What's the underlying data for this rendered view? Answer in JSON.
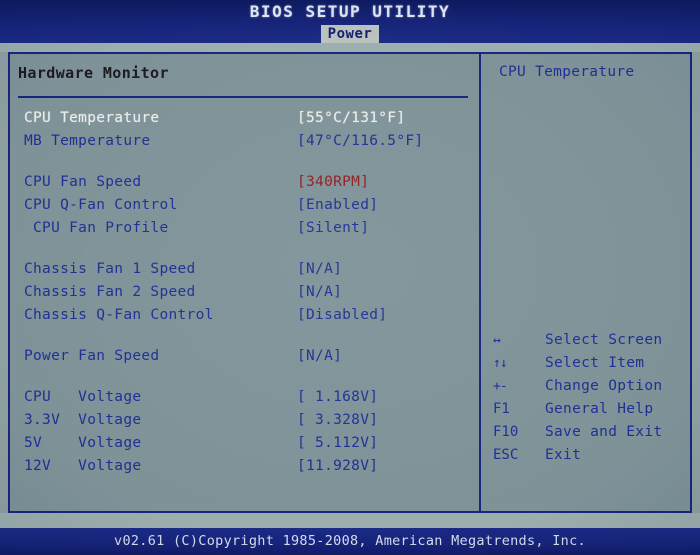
{
  "header": {
    "title": "BIOS SETUP UTILITY",
    "tabs": [
      {
        "label": "Power",
        "active": true
      }
    ]
  },
  "main": {
    "section_title": "Hardware Monitor",
    "rows": [
      {
        "label": "CPU Temperature",
        "value": "[55°C/131°F]",
        "selected": true,
        "alert": false
      },
      {
        "label": "MB Temperature",
        "value": "[47°C/116.5°F]",
        "selected": false,
        "alert": false
      },
      {
        "spacer": true
      },
      {
        "label": "CPU Fan Speed",
        "value": "[340RPM]",
        "selected": false,
        "alert": true
      },
      {
        "label": "CPU Q-Fan Control",
        "value": "[Enabled]",
        "selected": false,
        "alert": false
      },
      {
        "label": " CPU Fan Profile",
        "value": "[Silent]",
        "selected": false,
        "alert": false
      },
      {
        "spacer": true
      },
      {
        "label": "Chassis Fan 1 Speed",
        "value": "[N/A]",
        "selected": false,
        "alert": false
      },
      {
        "label": "Chassis Fan 2 Speed",
        "value": "[N/A]",
        "selected": false,
        "alert": false
      },
      {
        "label": "Chassis Q-Fan Control",
        "value": "[Disabled]",
        "selected": false,
        "alert": false
      },
      {
        "spacer": true
      },
      {
        "label": "Power Fan Speed",
        "value": "[N/A]",
        "selected": false,
        "alert": false
      },
      {
        "spacer": true
      },
      {
        "label": "CPU   Voltage",
        "value": "[ 1.168V]",
        "selected": false,
        "alert": false
      },
      {
        "label": "3.3V  Voltage",
        "value": "[ 3.328V]",
        "selected": false,
        "alert": false
      },
      {
        "label": "5V    Voltage",
        "value": "[ 5.112V]",
        "selected": false,
        "alert": false
      },
      {
        "label": "12V   Voltage",
        "value": "[11.928V]",
        "selected": false,
        "alert": false
      }
    ]
  },
  "help": {
    "title": "CPU Temperature",
    "legend": [
      {
        "key": "↔",
        "icon": "left-right-arrow-icon",
        "desc": "Select Screen"
      },
      {
        "key": "↑↓",
        "icon": "up-down-arrow-icon",
        "desc": "Select Item"
      },
      {
        "key": "+-",
        "icon": "plus-minus-icon",
        "desc": "Change Option"
      },
      {
        "key": "F1",
        "icon": "f1-key-icon",
        "desc": "General Help"
      },
      {
        "key": "F10",
        "icon": "f10-key-icon",
        "desc": "Save and Exit"
      },
      {
        "key": "ESC",
        "icon": "esc-key-icon",
        "desc": "Exit"
      }
    ]
  },
  "footer": {
    "text": "v02.61 (C)Copyright 1985-2008, American Megatrends, Inc."
  },
  "colors": {
    "header_bg": "#152276",
    "panel_bg": "#7e9298",
    "border": "#16267e",
    "text_blue": "#1e2f93",
    "text_selected": "#e9eeea",
    "text_alert": "#8f1d20",
    "tab_active_bg": "#b9c2c0"
  }
}
